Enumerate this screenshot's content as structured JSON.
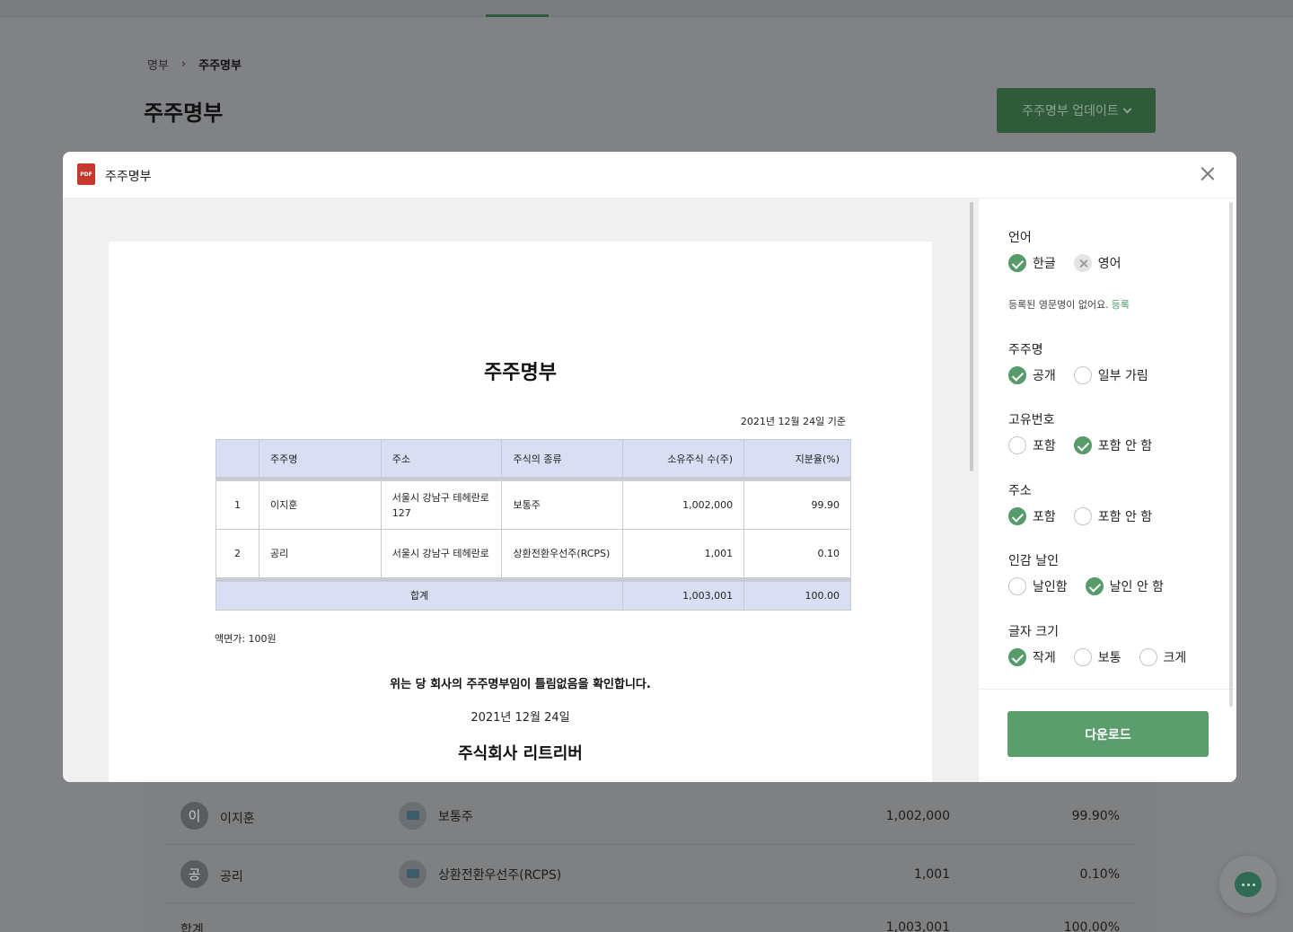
{
  "background": {
    "breadcrumb": {
      "parent": "명부",
      "separator": "›",
      "current": "주주명부"
    },
    "title": "주주명부",
    "update_button": "주주명부 업데이트",
    "rows": [
      {
        "avatar": "이",
        "name": "이지훈",
        "stock_type": "보통주",
        "shares": "1,002,000",
        "ratio": "99.90%"
      },
      {
        "avatar": "공",
        "name": "공리",
        "stock_type": "상환전환우선주(RCPS)",
        "shares": "1,001",
        "ratio": "0.10%"
      }
    ],
    "total": {
      "label": "합계",
      "shares": "1,003,001",
      "ratio": "100.00%"
    }
  },
  "modal": {
    "file_badge": "PDF",
    "title": "주주명부",
    "document": {
      "title": "주주명부",
      "date_basis": "2021년 12월 24일 기준",
      "headers": [
        "",
        "주주명",
        "주소",
        "주식의 종류",
        "소유주식 수(주)",
        "지분율(%)"
      ],
      "rows": [
        {
          "no": "1",
          "name": "이지훈",
          "address": "서울시 강남구 테헤란로 127",
          "type": "보통주",
          "shares": "1,002,000",
          "ratio": "99.90"
        },
        {
          "no": "2",
          "name": "공리",
          "address": "서울시 강남구 테헤란로",
          "type": "상환전환우선주(RCPS)",
          "shares": "1,001",
          "ratio": "0.10"
        }
      ],
      "total": {
        "label": "합계",
        "shares": "1,003,001",
        "ratio": "100.00"
      },
      "par_value": "액면가: 100원",
      "confirm_text": "위는 당 회사의 주주명부임이 틀림없음을 확인합니다.",
      "issue_date": "2021년 12월 24일",
      "company": "주식회사 리트리버"
    },
    "options": {
      "language": {
        "label": "언어",
        "choices": [
          "한글",
          "영어"
        ]
      },
      "note": {
        "text": "등록된 영문명이 없어요.",
        "link": "등록"
      },
      "shareholder_name": {
        "label": "주주명",
        "choices": [
          "공개",
          "일부 가림"
        ]
      },
      "unique_number": {
        "label": "고유번호",
        "choices": [
          "포함",
          "포함 안 함"
        ]
      },
      "address": {
        "label": "주소",
        "choices": [
          "포함",
          "포함 안 함"
        ]
      },
      "seal": {
        "label": "인감 날인",
        "choices": [
          "날인함",
          "날인 안 함"
        ]
      },
      "font_size": {
        "label": "글자 크기",
        "choices": [
          "작게",
          "보통",
          "크게"
        ]
      }
    },
    "download_button": "다운로드"
  },
  "colors": {
    "accent": "#5b9e6d",
    "header_fill": "#d9def3",
    "pdf_badge": "#c8372d"
  }
}
